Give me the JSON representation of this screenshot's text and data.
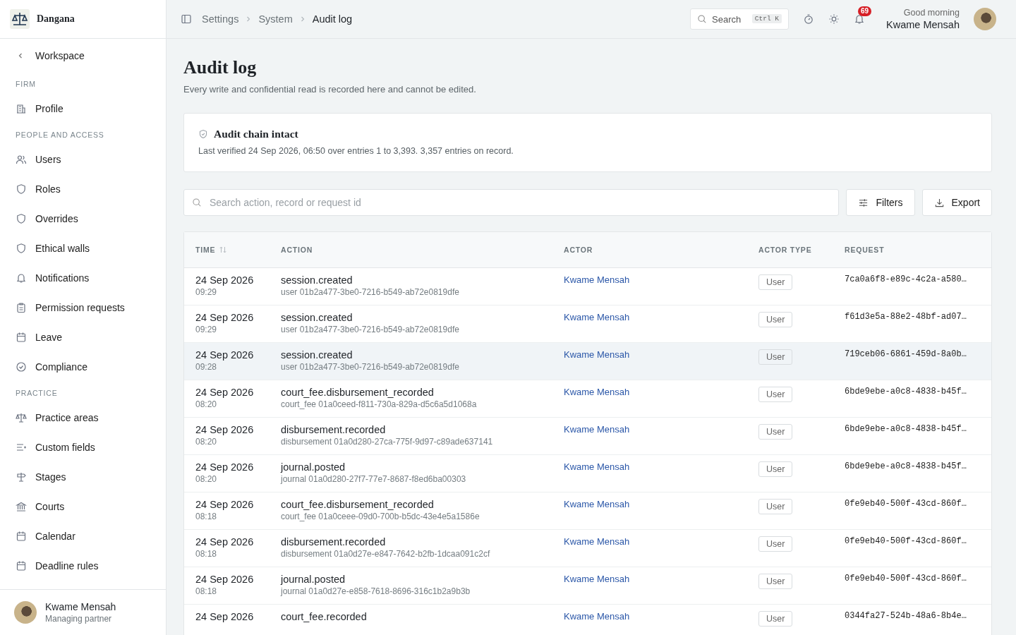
{
  "brand": {
    "name": "Dangana"
  },
  "sidebar": {
    "back": "Workspace",
    "sections": [
      {
        "heading": "FIRM",
        "items": [
          {
            "label": "Profile",
            "selected": false
          }
        ]
      },
      {
        "heading": "PEOPLE AND ACCESS",
        "items": [
          {
            "label": "Users",
            "selected": false
          },
          {
            "label": "Roles",
            "selected": false
          },
          {
            "label": "Overrides",
            "selected": false
          },
          {
            "label": "Ethical walls",
            "selected": false
          },
          {
            "label": "Notifications",
            "selected": false
          },
          {
            "label": "Permission requests",
            "selected": false
          },
          {
            "label": "Leave",
            "selected": false
          },
          {
            "label": "Compliance",
            "selected": false
          }
        ]
      },
      {
        "heading": "PRACTICE",
        "items": [
          {
            "label": "Practice areas",
            "selected": false
          },
          {
            "label": "Custom fields",
            "selected": false
          },
          {
            "label": "Stages",
            "selected": false
          },
          {
            "label": "Courts",
            "selected": false
          },
          {
            "label": "Calendar",
            "selected": false
          },
          {
            "label": "Deadline rules",
            "selected": false
          }
        ]
      }
    ],
    "user": {
      "name": "Kwame Mensah",
      "role": "Managing partner"
    }
  },
  "breadcrumbs": [
    "Settings",
    "System",
    "Audit log"
  ],
  "topbar": {
    "search": {
      "placeholder": "Search",
      "shortcut": "Ctrl K"
    },
    "notification_count": "69",
    "greeting": "Good morning",
    "user_name": "Kwame Mensah"
  },
  "page": {
    "title": "Audit log",
    "subtitle": "Every write and confidential read is recorded here and cannot be edited."
  },
  "chain_card": {
    "title": "Audit chain intact",
    "text": "Last verified 24 Sep 2026, 06:50 over entries 1 to 3,393. 3,357 entries on record."
  },
  "toolbar": {
    "search": {
      "placeholder": "Search action, record or request id"
    },
    "buttons": [
      "Filters",
      "Export"
    ]
  },
  "table": {
    "columns": [
      "TIME",
      "ACTION",
      "ACTOR",
      "ACTOR TYPE",
      "REQUEST"
    ],
    "rows": [
      {
        "date": "24 Sep 2026",
        "time": "09:29",
        "action": "session.created",
        "record": "user 01b2a477-3be0-7216-b549-ab72e0819dfe",
        "actor": "Kwame Mensah",
        "actor_type": "User",
        "request": "7ca0a6f8-e89c-4c2a-a580…",
        "highlighted": false
      },
      {
        "date": "24 Sep 2026",
        "time": "09:29",
        "action": "session.created",
        "record": "user 01b2a477-3be0-7216-b549-ab72e0819dfe",
        "actor": "Kwame Mensah",
        "actor_type": "User",
        "request": "f61d3e5a-88e2-48bf-ad07…",
        "highlighted": false
      },
      {
        "date": "24 Sep 2026",
        "time": "09:28",
        "action": "session.created",
        "record": "user 01b2a477-3be0-7216-b549-ab72e0819dfe",
        "actor": "Kwame Mensah",
        "actor_type": "User",
        "request": "719ceb06-6861-459d-8a0b…",
        "highlighted": true
      },
      {
        "date": "24 Sep 2026",
        "time": "08:20",
        "action": "court_fee.disbursement_recorded",
        "record": "court_fee 01a0ceed-f811-730a-829a-d5c6a5d1068a",
        "actor": "Kwame Mensah",
        "actor_type": "User",
        "request": "6bde9ebe-a0c8-4838-b45f…",
        "highlighted": false
      },
      {
        "date": "24 Sep 2026",
        "time": "08:20",
        "action": "disbursement.recorded",
        "record": "disbursement 01a0d280-27ca-775f-9d97-c89ade637141",
        "actor": "Kwame Mensah",
        "actor_type": "User",
        "request": "6bde9ebe-a0c8-4838-b45f…",
        "highlighted": false
      },
      {
        "date": "24 Sep 2026",
        "time": "08:20",
        "action": "journal.posted",
        "record": "journal 01a0d280-27f7-77e7-8687-f8ed6ba00303",
        "actor": "Kwame Mensah",
        "actor_type": "User",
        "request": "6bde9ebe-a0c8-4838-b45f…",
        "highlighted": false
      },
      {
        "date": "24 Sep 2026",
        "time": "08:18",
        "action": "court_fee.disbursement_recorded",
        "record": "court_fee 01a0ceee-09d0-700b-b5dc-43e4e5a1586e",
        "actor": "Kwame Mensah",
        "actor_type": "User",
        "request": "0fe9eb40-500f-43cd-860f…",
        "highlighted": false
      },
      {
        "date": "24 Sep 2026",
        "time": "08:18",
        "action": "disbursement.recorded",
        "record": "disbursement 01a0d27e-e847-7642-b2fb-1dcaa091c2cf",
        "actor": "Kwame Mensah",
        "actor_type": "User",
        "request": "0fe9eb40-500f-43cd-860f…",
        "highlighted": false
      },
      {
        "date": "24 Sep 2026",
        "time": "08:18",
        "action": "journal.posted",
        "record": "journal 01a0d27e-e858-7618-8696-316c1b2a9b3b",
        "actor": "Kwame Mensah",
        "actor_type": "User",
        "request": "0fe9eb40-500f-43cd-860f…",
        "highlighted": false
      },
      {
        "date": "24 Sep 2026",
        "action": "court_fee.recorded",
        "actor": "Kwame Mensah",
        "actor_type": "User",
        "request": "0344fa27-524b-48a6-8b4e…",
        "highlighted": false
      }
    ]
  }
}
